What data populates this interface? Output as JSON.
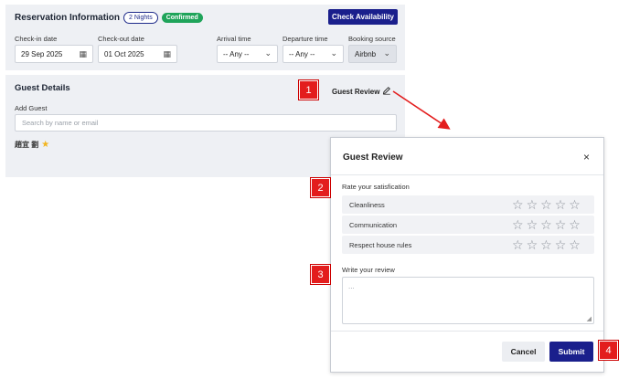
{
  "reservation": {
    "title": "Reservation Information",
    "nights_badge": "2 Nights",
    "status_badge": "Confirmed",
    "check_availability": "Check Availability",
    "checkin_label": "Check-in date",
    "checkin_value": "29 Sep 2025",
    "checkout_label": "Check-out date",
    "checkout_value": "01 Oct 2025",
    "arrival_label": "Arrival time",
    "arrival_value": "-- Any --",
    "departure_label": "Departure time",
    "departure_value": "-- Any --",
    "source_label": "Booking source",
    "source_value": "Airbnb"
  },
  "guest": {
    "title": "Guest Details",
    "review_link": "Guest Review",
    "add_label": "Add Guest",
    "search_placeholder": "Search by name or email",
    "guest_name": "趙宜 劉"
  },
  "modal": {
    "title": "Guest Review",
    "close_glyph": "×",
    "satisfaction_label": "Rate your satisfication",
    "criteria": [
      {
        "label": "Cleanliness",
        "rating": 0,
        "max": 5
      },
      {
        "label": "Communication",
        "rating": 0,
        "max": 5
      },
      {
        "label": "Respect house rules",
        "rating": 0,
        "max": 5
      }
    ],
    "review_label": "Write your review",
    "review_placeholder": "...",
    "cancel": "Cancel",
    "submit": "Submit"
  },
  "markers": [
    "1",
    "2",
    "3",
    "4"
  ],
  "colors": {
    "primary": "#1a1f8c",
    "confirmed": "#1fa45a",
    "marker": "#e31d1d",
    "star": "#f2b41c",
    "panel": "#eef0f4"
  },
  "icons": {
    "calendar": "calendar-icon",
    "chevron": "chevron-down-icon",
    "edit": "pencil-icon",
    "star": "star-icon",
    "close": "close-icon"
  }
}
